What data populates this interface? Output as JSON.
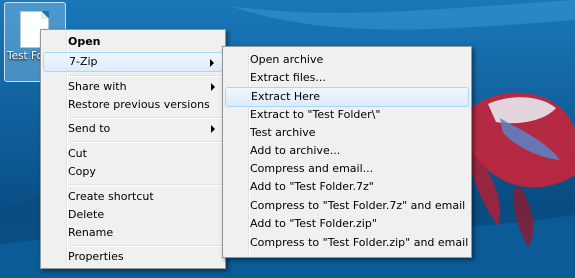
{
  "desktop": {
    "icon_name": "file-icon",
    "icon_label": "Test Folder"
  },
  "context_menu": {
    "items": [
      {
        "label": "Open",
        "bold": true
      },
      {
        "label": "7-Zip",
        "submenu": true
      },
      {
        "label": "Share with",
        "submenu": true
      },
      {
        "label": "Restore previous versions"
      },
      {
        "label": "Send to",
        "submenu": true
      },
      {
        "label": "Cut"
      },
      {
        "label": "Copy"
      },
      {
        "label": "Create shortcut"
      },
      {
        "label": "Delete"
      },
      {
        "label": "Rename"
      },
      {
        "label": "Properties"
      }
    ]
  },
  "zip_submenu": {
    "items": [
      {
        "label": "Open archive"
      },
      {
        "label": "Extract files..."
      },
      {
        "label": "Extract Here",
        "highlighted": true
      },
      {
        "label": "Extract to \"Test Folder\\\""
      },
      {
        "label": "Test archive"
      },
      {
        "label": "Add to archive..."
      },
      {
        "label": "Compress and email..."
      },
      {
        "label": "Add to \"Test Folder.7z\""
      },
      {
        "label": "Compress to \"Test Folder.7z\" and email"
      },
      {
        "label": "Add to \"Test Folder.zip\""
      },
      {
        "label": "Compress to \"Test Folder.zip\" and email"
      }
    ]
  }
}
